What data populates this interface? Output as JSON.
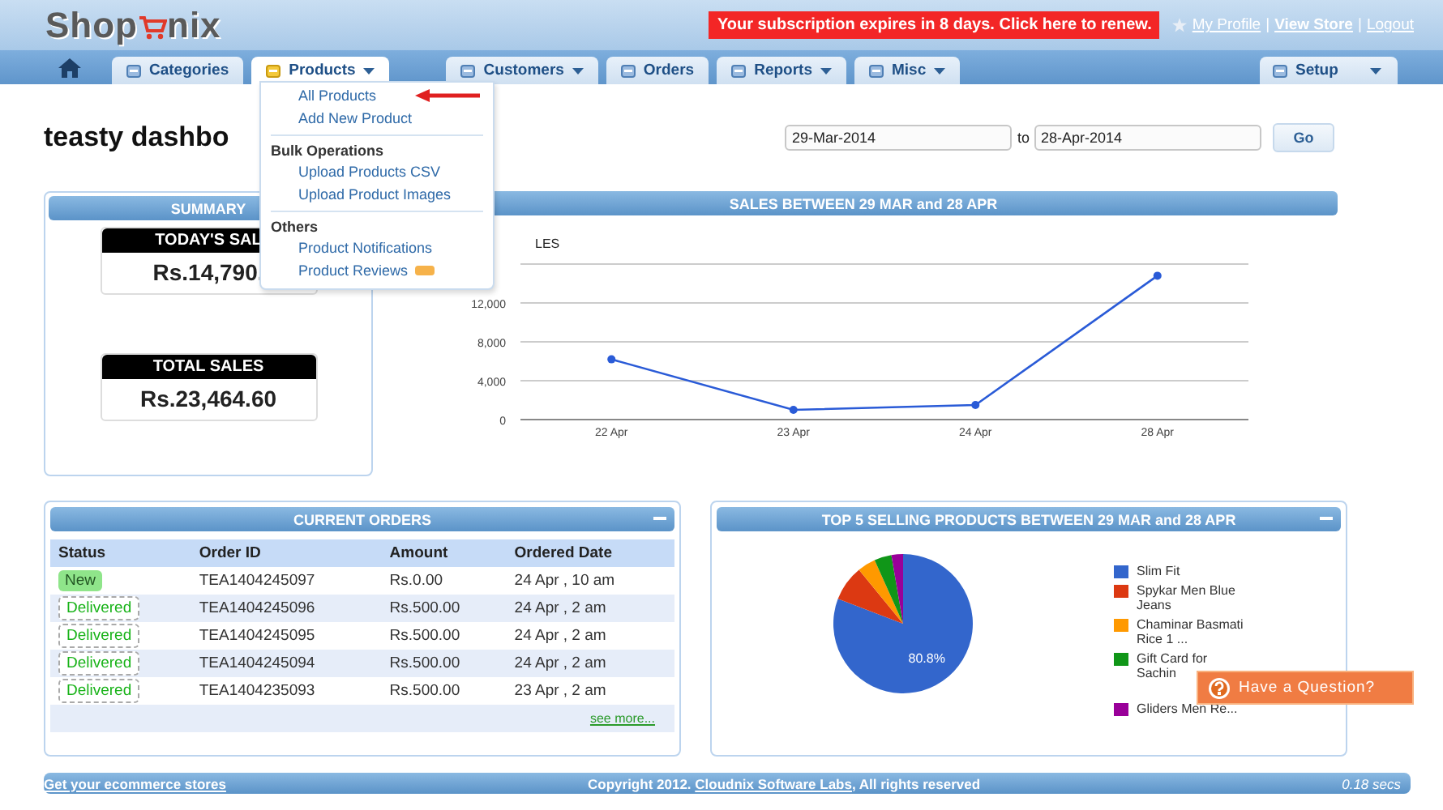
{
  "header": {
    "logo": {
      "left": "Shop",
      "right": "nix"
    },
    "notice": "Your subscription expires in 8 days. Click here to renew.",
    "links": [
      "My Profile",
      "View Store",
      "Logout"
    ],
    "separator": "|"
  },
  "tabs": [
    {
      "label": "Categories",
      "selected": false,
      "dropdown": false
    },
    {
      "label": "Products",
      "selected": true,
      "dropdown": true
    },
    {
      "label": "Customers",
      "selected": false,
      "dropdown": true
    },
    {
      "label": "Orders",
      "selected": false,
      "dropdown": false
    },
    {
      "label": "Reports",
      "selected": false,
      "dropdown": true
    },
    {
      "label": "Misc",
      "selected": false,
      "dropdown": true
    },
    {
      "label": "Setup",
      "selected": false,
      "dropdown": true
    }
  ],
  "menu": {
    "sections": [
      {
        "items": [
          {
            "label": "All Products",
            "pointed": true,
            "new": false
          },
          {
            "label": "Add New Product",
            "pointed": false,
            "new": false
          }
        ]
      },
      {
        "heading": "Bulk Operations",
        "items": [
          {
            "label": "Upload Products CSV",
            "pointed": false,
            "new": false
          },
          {
            "label": "Upload Product Images",
            "pointed": false,
            "new": false
          }
        ]
      },
      {
        "heading": "Others",
        "items": [
          {
            "label": "Product Notifications",
            "pointed": false,
            "new": false
          },
          {
            "label": "Product Reviews",
            "pointed": false,
            "new": true
          }
        ]
      }
    ]
  },
  "page_title": "teasty dashbo",
  "date_range": {
    "from": "29-Mar-2014",
    "separator": "to",
    "to": "28-Apr-2014",
    "button": "Go"
  },
  "summary": {
    "title": "SUMMARY",
    "cards": [
      {
        "label": "TODAY'S SAL",
        "value": "Rs.14,790."
      },
      {
        "label": "TOTAL SALES",
        "value": "Rs.23,464.60"
      }
    ]
  },
  "sales": {
    "title": "SALES BETWEEN 29 MAR and 28 APR",
    "chart_data": {
      "type": "line",
      "title": "LES",
      "grid": true,
      "categories": [
        "22 Apr",
        "23 Apr",
        "24 Apr",
        "28 Apr"
      ],
      "series": [
        {
          "color": "#2a5bd7",
          "marker": "circle",
          "values": [
            6200,
            1000,
            1500,
            14800
          ]
        }
      ],
      "ylim": [
        0,
        16000
      ],
      "yticks": [
        {
          "value": 0,
          "label": "0"
        },
        {
          "value": 4000,
          "label": "4,000"
        },
        {
          "value": 8000,
          "label": "8,000"
        },
        {
          "value": 12000,
          "label": "12,000"
        }
      ]
    }
  },
  "orders": {
    "title": "CURRENT ORDERS",
    "columns": [
      "Status",
      "Order ID",
      "Amount",
      "Ordered Date"
    ],
    "rows": [
      {
        "status": "New",
        "kind": "new",
        "id": "TEA1404245097",
        "amount": "Rs.0.00",
        "date": "24 Apr , 10 am"
      },
      {
        "status": "Delivered",
        "kind": "delivered",
        "id": "TEA1404245096",
        "amount": "Rs.500.00",
        "date": "24 Apr , 2 am"
      },
      {
        "status": "Delivered",
        "kind": "delivered",
        "id": "TEA1404245095",
        "amount": "Rs.500.00",
        "date": "24 Apr , 2 am"
      },
      {
        "status": "Delivered",
        "kind": "delivered",
        "id": "TEA1404245094",
        "amount": "Rs.500.00",
        "date": "24 Apr , 2 am"
      },
      {
        "status": "Delivered",
        "kind": "delivered",
        "id": "TEA1404235093",
        "amount": "Rs.500.00",
        "date": "23 Apr , 2 am"
      }
    ],
    "more": "see more..."
  },
  "top_products": {
    "title": "TOP 5 SELLING PRODUCTS BETWEEN 29 MAR and 28 APR",
    "chart_data": {
      "type": "pie",
      "categories": [
        "Slim Fit",
        "Spykar Men Blue Jeans",
        "Chaminar Basmati Rice 1 ...",
        "Gift Card for Sachin",
        "Gliders Men Re..."
      ],
      "series": [
        {
          "values": [
            80.8,
            8.3,
            4.2,
            4.0,
            2.7
          ]
        }
      ],
      "colors": [
        "#3366cc",
        "#dc3912",
        "#ff9900",
        "#109618",
        "#990099"
      ],
      "value_labels": [
        "80.8%",
        null,
        null,
        null,
        null
      ]
    }
  },
  "footer": {
    "left": "Get your ecommerce stores",
    "copyright_prefix": "Copyright 2012. ",
    "copyright_link": "Cloudnix Software Labs",
    "copyright_suffix": ", All rights reserved",
    "timing": "0.18 secs"
  },
  "help_button": "Have a Question?"
}
